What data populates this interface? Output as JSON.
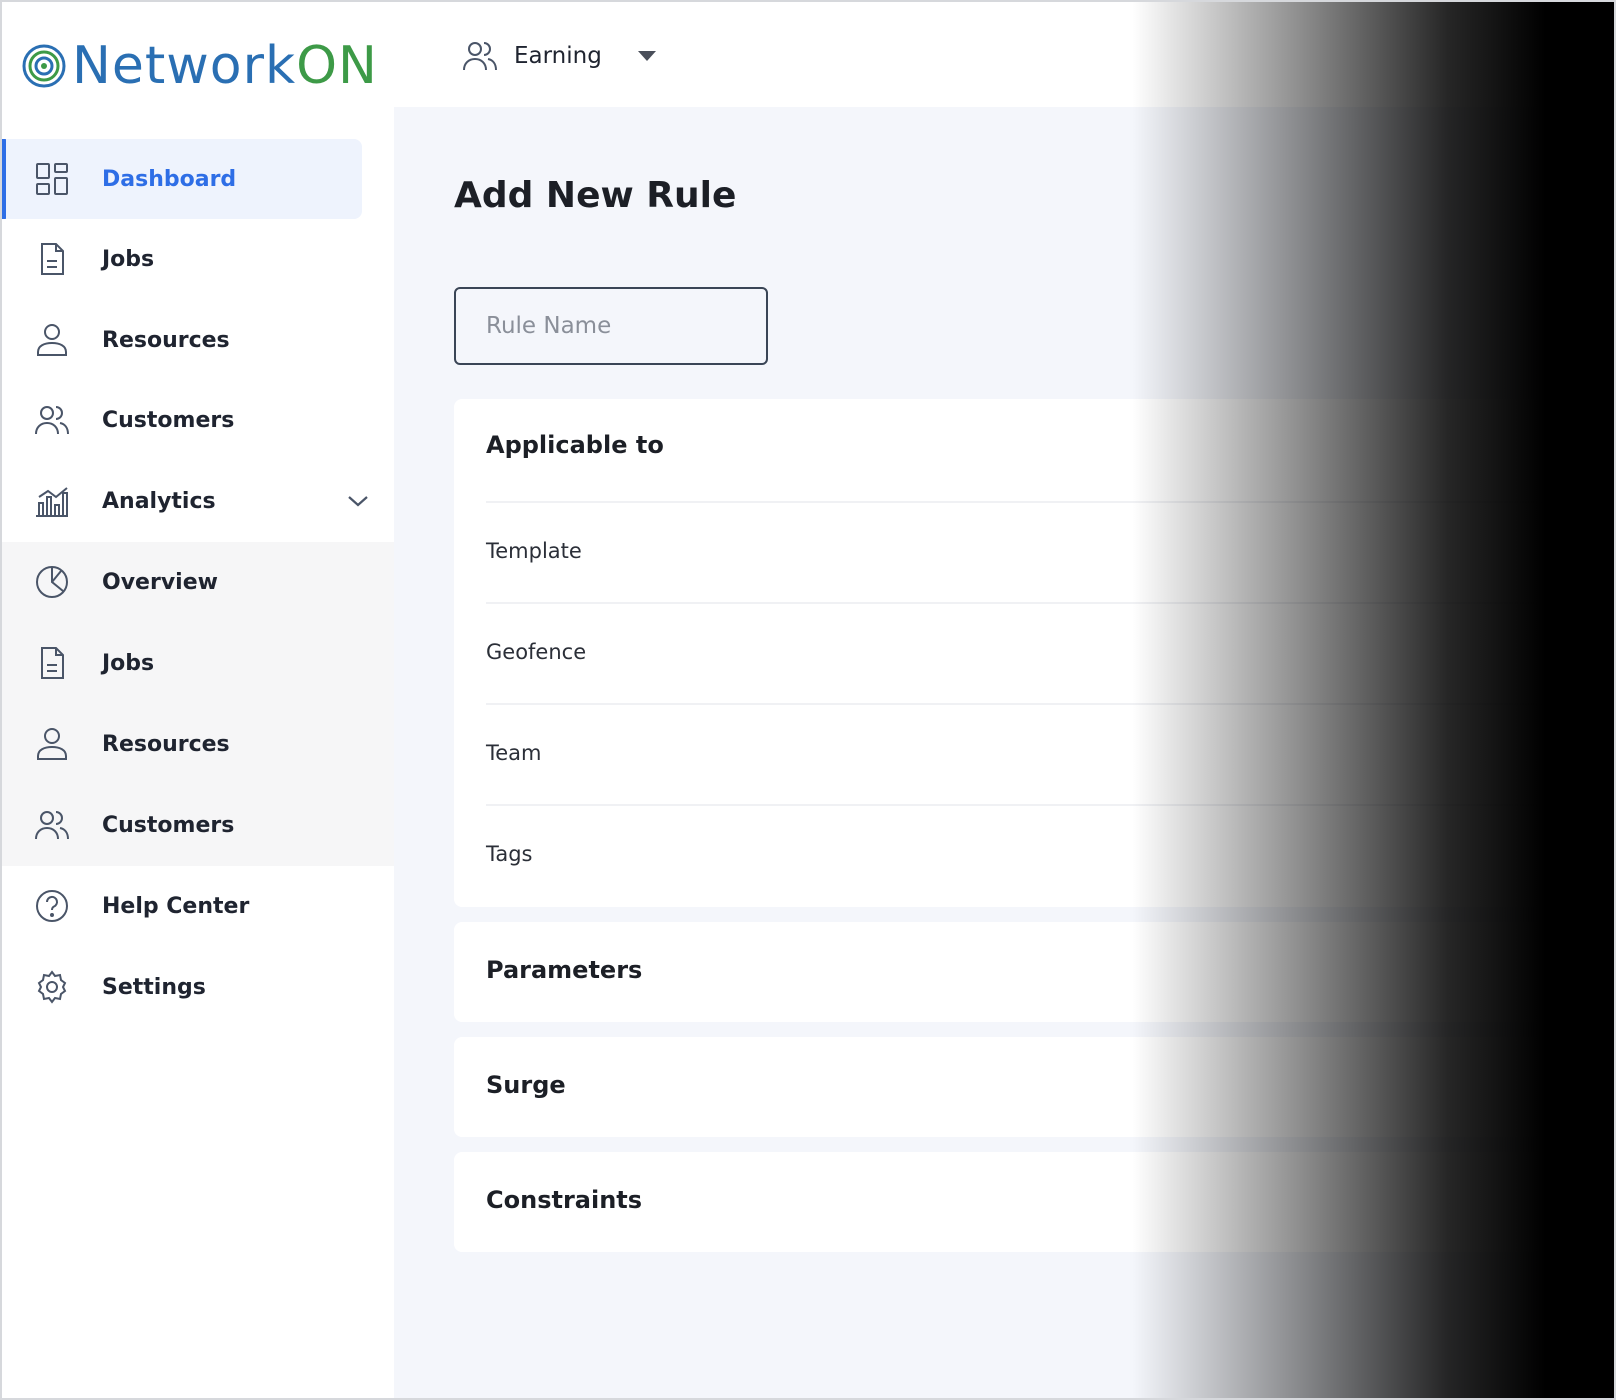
{
  "brand": {
    "name_part1": "Network",
    "name_part2": "ON",
    "colors": {
      "part1": "#2a6fb3",
      "part2": "#3d9a47"
    }
  },
  "header": {
    "switcher": {
      "icon": "users-icon",
      "label": "Earning"
    }
  },
  "sidebar": {
    "accent": "#2e6ee6",
    "items": [
      {
        "label": "Dashboard",
        "icon": "grid-icon",
        "active": true
      },
      {
        "label": "Jobs",
        "icon": "document-icon"
      },
      {
        "label": "Resources",
        "icon": "user-icon"
      },
      {
        "label": "Customers",
        "icon": "users-icon"
      },
      {
        "label": "Analytics",
        "icon": "bar-chart-icon",
        "expandable": true
      },
      {
        "label": "Overview",
        "icon": "pie-chart-icon"
      },
      {
        "label": "Jobs",
        "icon": "document-icon"
      },
      {
        "label": "Resources",
        "icon": "user-icon"
      },
      {
        "label": "Customers",
        "icon": "users-icon"
      },
      {
        "label": "Help Center",
        "icon": "help-icon"
      },
      {
        "label": "Settings",
        "icon": "gear-icon"
      }
    ]
  },
  "main": {
    "title": "Add New Rule",
    "rule_name_placeholder": "Rule Name",
    "applicable": {
      "title": "Applicable to",
      "rows": [
        "Template",
        "Geofence",
        "Team",
        "Tags"
      ]
    },
    "sections": [
      "Parameters",
      "Surge",
      "Constraints"
    ]
  }
}
